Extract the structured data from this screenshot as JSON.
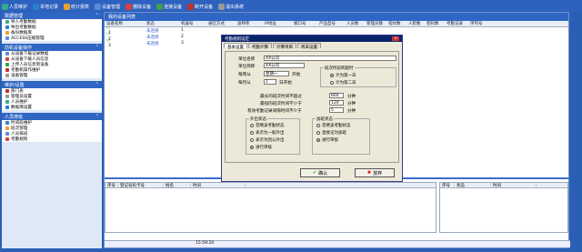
{
  "toolbar": {
    "items": [
      "人员维护",
      "本地记录",
      "统计报表",
      "设备管理",
      "删除设备",
      "连接设备",
      "断开设备",
      "退出系统"
    ]
  },
  "sidebar": {
    "groups": [
      {
        "title": "数据管理",
        "items": [
          "导入考勤数据",
          "导出考勤数据",
          "备份数据库",
          "ACCESS压缩管理"
        ]
      },
      {
        "title": "前机设备操作",
        "items": [
          "从设备下载记录数据",
          "从设备下载人员信息",
          "上传人员信息到设备",
          "考勤机操作维护",
          "设备管理"
        ]
      },
      {
        "title": "维护/设置",
        "items": [
          "部门表",
          "管理员设置",
          "人员维护",
          "数据库设置"
        ]
      },
      {
        "title": "人员排班",
        "items": [
          "时间段维护",
          "班次管理",
          "人员排班",
          "考勤规则"
        ]
      }
    ]
  },
  "main": {
    "title": "我的设备列表",
    "columns": [
      "设备名称",
      "状态",
      "机器号",
      "通信方式",
      "波特率",
      "IP地址",
      "端口号",
      "产品型号",
      "人员数",
      "管理员数",
      "指纹数",
      "人脸数",
      "密码数",
      "考勤记录",
      "序列号"
    ],
    "rows": [
      {
        "name": "1",
        "status": "未连接",
        "num": "1"
      },
      {
        "name": "2",
        "status": "未连接",
        "num": "2"
      },
      {
        "name": "3",
        "status": "未连接",
        "num": "3"
      }
    ],
    "lower_left_cols": [
      "序号",
      "登记号码卡号",
      "姓名",
      "时间"
    ],
    "lower_right_cols": [
      "序号",
      "状态",
      "时间"
    ],
    "status_time": "15:59:20"
  },
  "dialog": {
    "title": "考勤规则设定",
    "tabs": [
      "基本设置",
      "考勤计算",
      "计算项目",
      "周末设置"
    ],
    "unit_name_label": "单位名称",
    "unit_name": "XX公司",
    "unit_short_label": "单位简称",
    "unit_short": "XX公司",
    "week_start_label": "每周从",
    "week_start": "星期一",
    "week_start_suffix": "开始",
    "month_start_label": "每月从",
    "month_start": "1",
    "month_start_suffix": "日开始",
    "cross_group": "班次时段跨越时",
    "cross_opt1": "计为第一日",
    "cross_opt2": "计为第二日",
    "r1_label": "最长的班次时间不超过",
    "r1_val": "660",
    "r2_label": "最短的班次时间不少于",
    "r2_val": "120",
    "r3_label": "有效考勤记录间隔时间不少于",
    "r3_val": "5",
    "unit_min": "分钟",
    "out_group": "外出状态",
    "out_opts": [
      "忽略该考勤状态",
      "表示为一般外出",
      "表示为因公外出",
      "进行审核"
    ],
    "ot_group": "加班状态",
    "ot_opts": [
      "忽略该考勤状态",
      "直接记为加班",
      "进行审核"
    ],
    "ok": "确认",
    "cancel": "放弃"
  },
  "colors": {
    "accent": "#2f66c4",
    "title": "#0a246a"
  }
}
